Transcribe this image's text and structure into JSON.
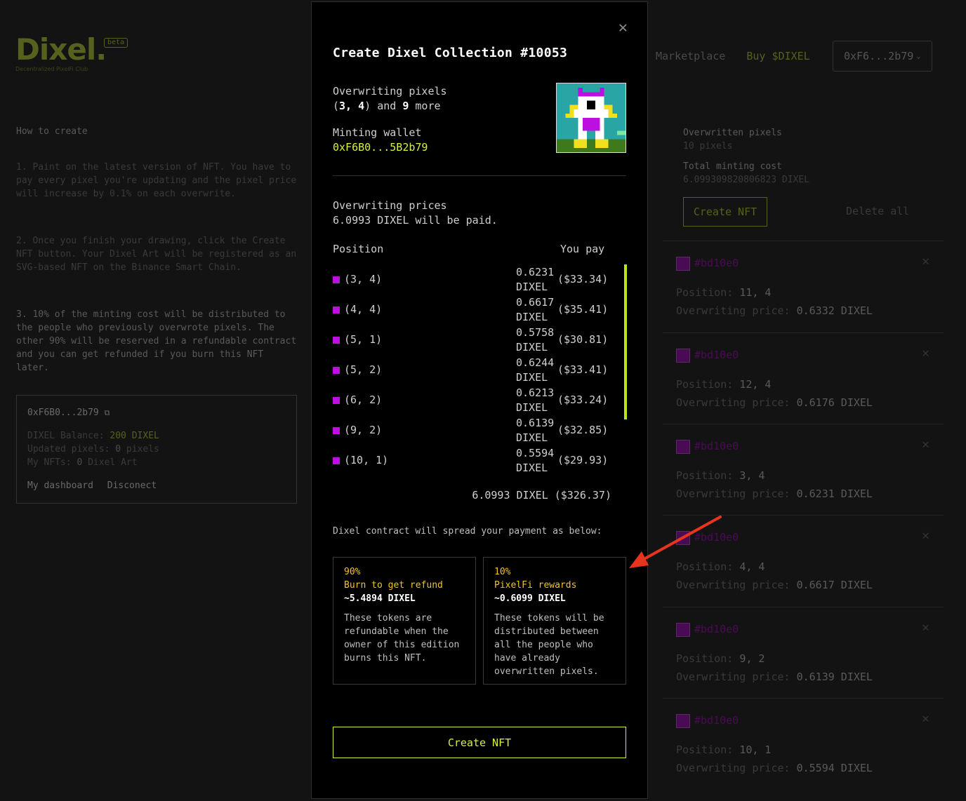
{
  "header": {
    "logo": "Dixel.",
    "beta": "beta",
    "tagline": "Decentralized PixelFi Club",
    "nav": [
      {
        "label": "Marketplace"
      },
      {
        "label": "Buy $DIXEL"
      }
    ],
    "wallet_button": "0xF6...2b79"
  },
  "howto": {
    "title": "How to create",
    "steps": [
      "1. Paint on the latest version of NFT. You have to pay every pixel you're updating and the pixel price will increase by 0.1% on each overwrite.",
      "2. Once you finish your drawing, click the Create NFT button. Your Dixel Art will be registered as an SVG-based NFT on the Binance Smart Chain.",
      "3. 10% of the minting cost will be distributed to the people who previously overwrote pixels. The other 90% will be reserved in a refundable contract and you can get refunded if you burn this NFT later."
    ]
  },
  "wallet_card": {
    "address": "0xF6B0...2b79",
    "balance_label": "DIXEL Balance:",
    "balance_value": "200 DIXEL",
    "updated_label": "Updated pixels:",
    "updated_value": "0",
    "updated_unit": "pixels",
    "nfts_label": "My NFTs:",
    "nfts_value": "0",
    "nfts_unit": "Dixel Art",
    "dashboard": "My dashboard",
    "disconnect": "Disconect"
  },
  "summary": {
    "overwritten_label": "Overwritten pixels",
    "overwritten_value": "10 pixels",
    "total_label": "Total minting cost",
    "total_value": "6.099309820806823 DIXEL",
    "create_button": "Create NFT",
    "delete_all": "Delete all"
  },
  "pixel_list": [
    {
      "hex": "#bd10e0",
      "pos_label": "Position:",
      "pos": "11, 4",
      "price_label": "Overwriting price:",
      "price": "0.6332 DIXEL"
    },
    {
      "hex": "#bd10e0",
      "pos_label": "Position:",
      "pos": "12, 4",
      "price_label": "Overwriting price:",
      "price": "0.6176 DIXEL"
    },
    {
      "hex": "#bd10e0",
      "pos_label": "Position:",
      "pos": "3, 4",
      "price_label": "Overwriting price:",
      "price": "0.6231 DIXEL"
    },
    {
      "hex": "#bd10e0",
      "pos_label": "Position:",
      "pos": "4, 4",
      "price_label": "Overwriting price:",
      "price": "0.6617 DIXEL"
    },
    {
      "hex": "#bd10e0",
      "pos_label": "Position:",
      "pos": "9, 2",
      "price_label": "Overwriting price:",
      "price": "0.6139 DIXEL"
    },
    {
      "hex": "#bd10e0",
      "pos_label": "Position:",
      "pos": "10, 1",
      "price_label": "Overwriting price:",
      "price": "0.5594 DIXEL"
    }
  ],
  "modal": {
    "title": "Create Dixel Collection #10053",
    "overwriting_label": "Overwriting pixels",
    "overwriting_first": "3, 4",
    "overwriting_and": "and",
    "overwriting_more_count": "9",
    "overwriting_more": "more",
    "minting_wallet_label": "Minting wallet",
    "minting_wallet": "0xF6B0...5B2b79",
    "prices_label": "Overwriting prices",
    "prices_paid": "6.0993 DIXEL will be paid.",
    "col_position": "Position",
    "col_you_pay": "You pay",
    "rows": [
      {
        "pos": "(3, 4)",
        "amount": "0.6231 DIXEL",
        "usd": "($33.34)"
      },
      {
        "pos": "(4, 4)",
        "amount": "0.6617 DIXEL",
        "usd": "($35.41)"
      },
      {
        "pos": "(5, 1)",
        "amount": "0.5758 DIXEL",
        "usd": "($30.81)"
      },
      {
        "pos": "(5, 2)",
        "amount": "0.6244 DIXEL",
        "usd": "($33.41)"
      },
      {
        "pos": "(6, 2)",
        "amount": "0.6213 DIXEL",
        "usd": "($33.24)"
      },
      {
        "pos": "(9, 2)",
        "amount": "0.6139 DIXEL",
        "usd": "($32.85)"
      },
      {
        "pos": "(10, 1)",
        "amount": "0.5594 DIXEL",
        "usd": "($29.93)"
      }
    ],
    "total": "6.0993 DIXEL ($326.37)",
    "spread_text": "Dixel contract will spread your payment as below:",
    "refund_box": {
      "pct": "90%",
      "name": "Burn to get refund",
      "amount": "~5.4894 DIXEL",
      "desc": "These tokens are refundable when the owner of this edition burns this NFT."
    },
    "reward_box": {
      "pct": "10%",
      "name": "PixelFi rewards",
      "amount": "~0.6099 DIXEL",
      "desc": "These tokens will be distributed between all the people who have already overwritten pixels."
    },
    "create_button": "Create NFT",
    "pixel_color": "#bd10e0",
    "accent": "#d8f03a"
  }
}
